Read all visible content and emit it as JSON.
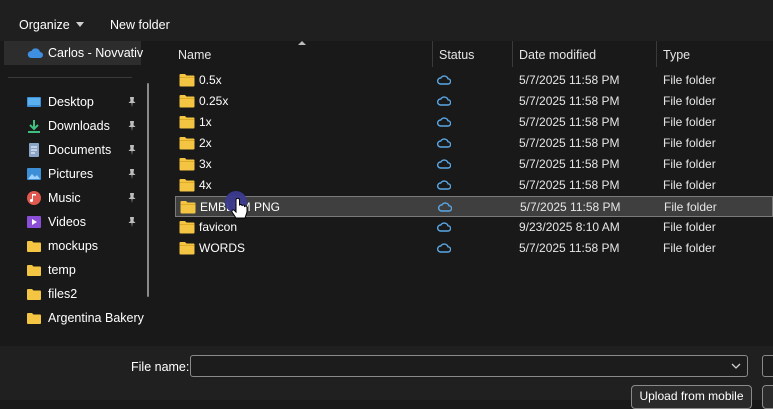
{
  "toolbar": {
    "organize_label": "Organize",
    "new_folder_label": "New folder"
  },
  "nav": {
    "top_item": {
      "label": "Carlos - Novvativ",
      "icon": "cloud-icon"
    },
    "items": [
      {
        "label": "Desktop",
        "icon": "desktop-icon",
        "pinned": true
      },
      {
        "label": "Downloads",
        "icon": "download-icon",
        "pinned": true
      },
      {
        "label": "Documents",
        "icon": "documents-icon",
        "pinned": true
      },
      {
        "label": "Pictures",
        "icon": "pictures-icon",
        "pinned": true
      },
      {
        "label": "Music",
        "icon": "music-icon",
        "pinned": true
      },
      {
        "label": "Videos",
        "icon": "videos-icon",
        "pinned": true
      },
      {
        "label": "mockups",
        "icon": "folder-icon",
        "pinned": false
      },
      {
        "label": "temp",
        "icon": "folder-icon",
        "pinned": false
      },
      {
        "label": "files2",
        "icon": "folder-icon",
        "pinned": false
      },
      {
        "label": "Argentina Bakery",
        "icon": "folder-icon",
        "pinned": false
      }
    ]
  },
  "columns": {
    "name": "Name",
    "status": "Status",
    "date_modified": "Date modified",
    "type": "Type"
  },
  "files": [
    {
      "name": "0.5x",
      "date": "5/7/2025 11:58 PM",
      "type": "File folder",
      "status": "cloud-icon"
    },
    {
      "name": "0.25x",
      "date": "5/7/2025 11:58 PM",
      "type": "File folder",
      "status": "cloud-icon"
    },
    {
      "name": "1x",
      "date": "5/7/2025 11:58 PM",
      "type": "File folder",
      "status": "cloud-icon"
    },
    {
      "name": "2x",
      "date": "5/7/2025 11:58 PM",
      "type": "File folder",
      "status": "cloud-icon"
    },
    {
      "name": "3x",
      "date": "5/7/2025 11:58 PM",
      "type": "File folder",
      "status": "cloud-icon"
    },
    {
      "name": "4x",
      "date": "5/7/2025 11:58 PM",
      "type": "File folder",
      "status": "cloud-icon"
    },
    {
      "name": "EMBLEM PNG",
      "date": "5/7/2025 11:58 PM",
      "type": "File folder",
      "status": "cloud-icon",
      "selected": true
    },
    {
      "name": "favicon",
      "date": "9/23/2025 8:10 AM",
      "type": "File folder",
      "status": "cloud-icon"
    },
    {
      "name": "WORDS",
      "date": "5/7/2025 11:58 PM",
      "type": "File folder",
      "status": "cloud-icon"
    }
  ],
  "bottom": {
    "file_name_label": "File name:",
    "file_name_value": "",
    "upload_label": "Upload from mobile"
  },
  "colors": {
    "background": "#191919",
    "folder": "#f4c542",
    "cloud": "#5aa7e6",
    "selection": "#3f3f3f",
    "cursor_highlight": "#3b3a8f"
  }
}
